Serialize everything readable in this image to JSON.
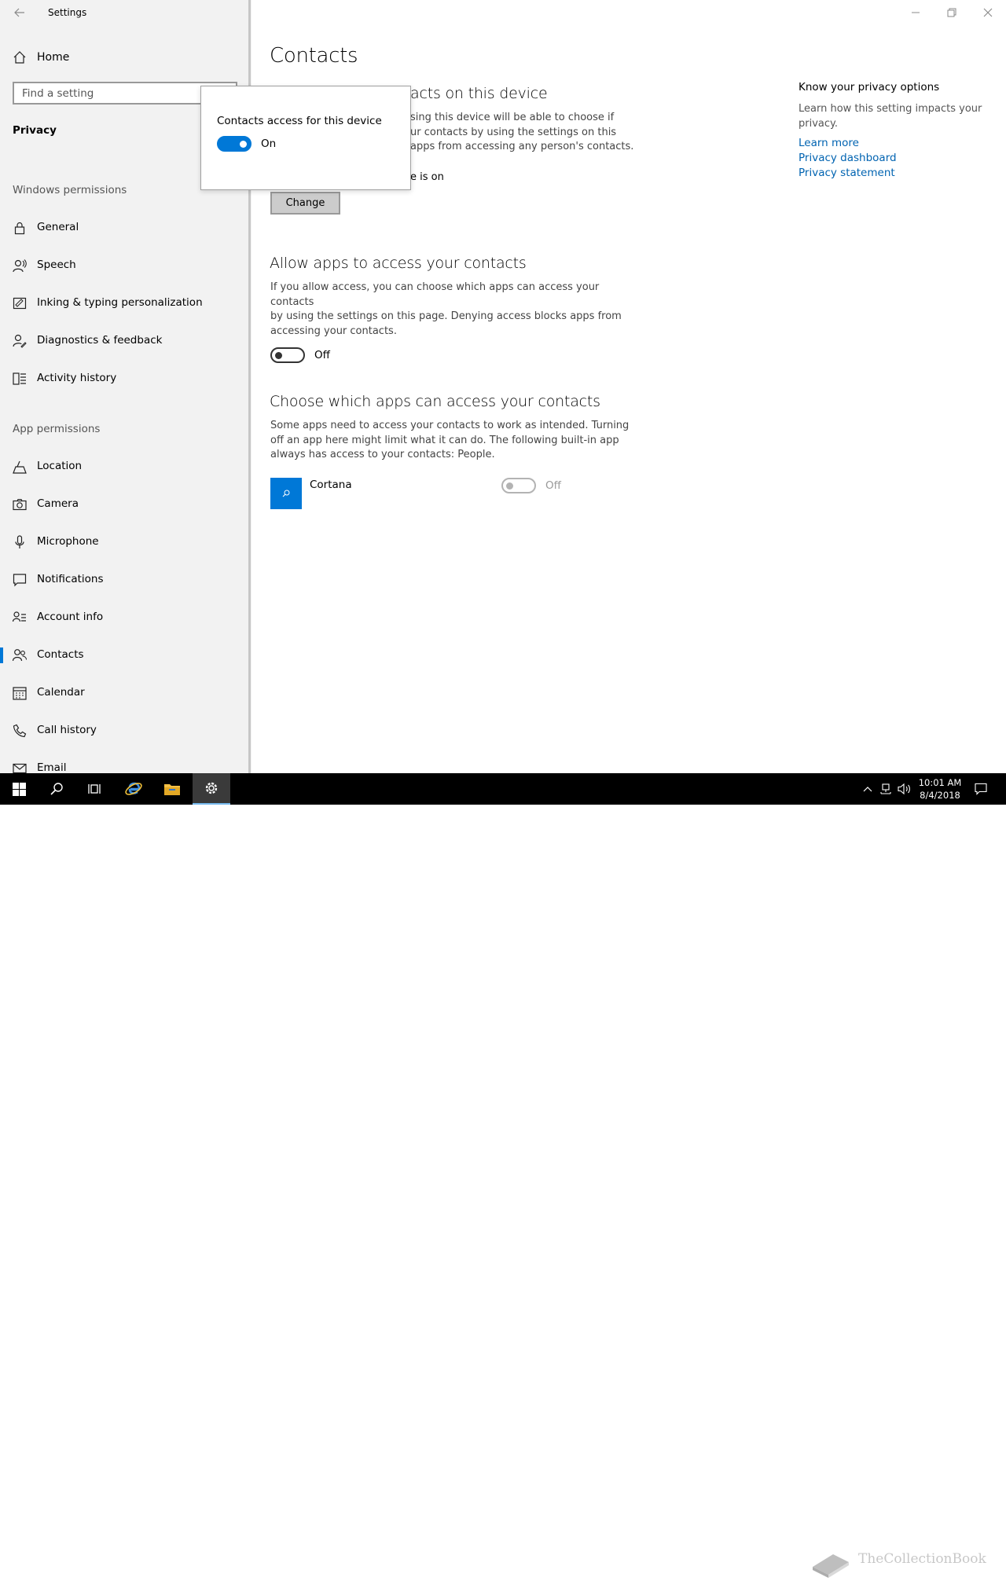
{
  "window": {
    "title": "Settings",
    "controls": [
      "minimize",
      "restore",
      "close"
    ]
  },
  "sidebar": {
    "home_label": "Home",
    "search_placeholder": "Find a setting",
    "section_title": "Privacy",
    "windows_permissions_header": "Windows permissions",
    "windows_permissions": [
      {
        "label": "General",
        "icon": "lock-icon"
      },
      {
        "label": "Speech",
        "icon": "speech-icon"
      },
      {
        "label": "Inking & typing personalization",
        "icon": "inking-icon"
      },
      {
        "label": "Diagnostics & feedback",
        "icon": "feedback-icon"
      },
      {
        "label": "Activity history",
        "icon": "activity-icon"
      }
    ],
    "app_permissions_header": "App permissions",
    "app_permissions": [
      {
        "label": "Location",
        "icon": "location-icon"
      },
      {
        "label": "Camera",
        "icon": "camera-icon"
      },
      {
        "label": "Microphone",
        "icon": "microphone-icon"
      },
      {
        "label": "Notifications",
        "icon": "notifications-icon"
      },
      {
        "label": "Account info",
        "icon": "account-info-icon"
      },
      {
        "label": "Contacts",
        "icon": "contacts-icon",
        "active": true
      },
      {
        "label": "Calendar",
        "icon": "calendar-icon"
      },
      {
        "label": "Call history",
        "icon": "call-history-icon"
      },
      {
        "label": "Email",
        "icon": "email-icon"
      }
    ]
  },
  "main": {
    "page_title": "Contacts",
    "section1": {
      "heading_visible": "acts on this device",
      "para_lines": [
        "sing this device will be able to choose if",
        "ur contacts by using the settings on this",
        "apps from accessing any person's contacts."
      ],
      "status_visible": "e is on",
      "change_button": "Change"
    },
    "section2": {
      "heading": "Allow apps to access your contacts",
      "para_lines": [
        "If you allow access, you can choose which apps can access your contacts",
        "by using the settings on this page. Denying access blocks apps from",
        "accessing your contacts."
      ],
      "toggle_label": "Off"
    },
    "section3": {
      "heading": "Choose which apps can access your contacts",
      "para_lines": [
        "Some apps need to access your contacts to work as intended. Turning",
        "off an app here might limit what it can do. The following built-in app",
        "always has access to your contacts: People."
      ],
      "apps": [
        {
          "name": "Cortana",
          "toggle_label": "Off",
          "icon": "cortana-search-icon"
        }
      ]
    }
  },
  "side_panel": {
    "heading": "Know your privacy options",
    "para_lines": [
      "Learn how this setting impacts your",
      "privacy."
    ],
    "links": [
      "Learn more",
      "Privacy dashboard",
      "Privacy statement"
    ]
  },
  "popup": {
    "title": "Contacts access for this device",
    "toggle_label": "On"
  },
  "taskbar": {
    "time": "10:01 AM",
    "date": "8/4/2018",
    "watermark": "TheCollectionBook"
  },
  "colors": {
    "accent": "#0078d7",
    "link": "#0063b1",
    "sidebar_bg": "#f2f2f2",
    "taskbar_bg": "#000000"
  }
}
